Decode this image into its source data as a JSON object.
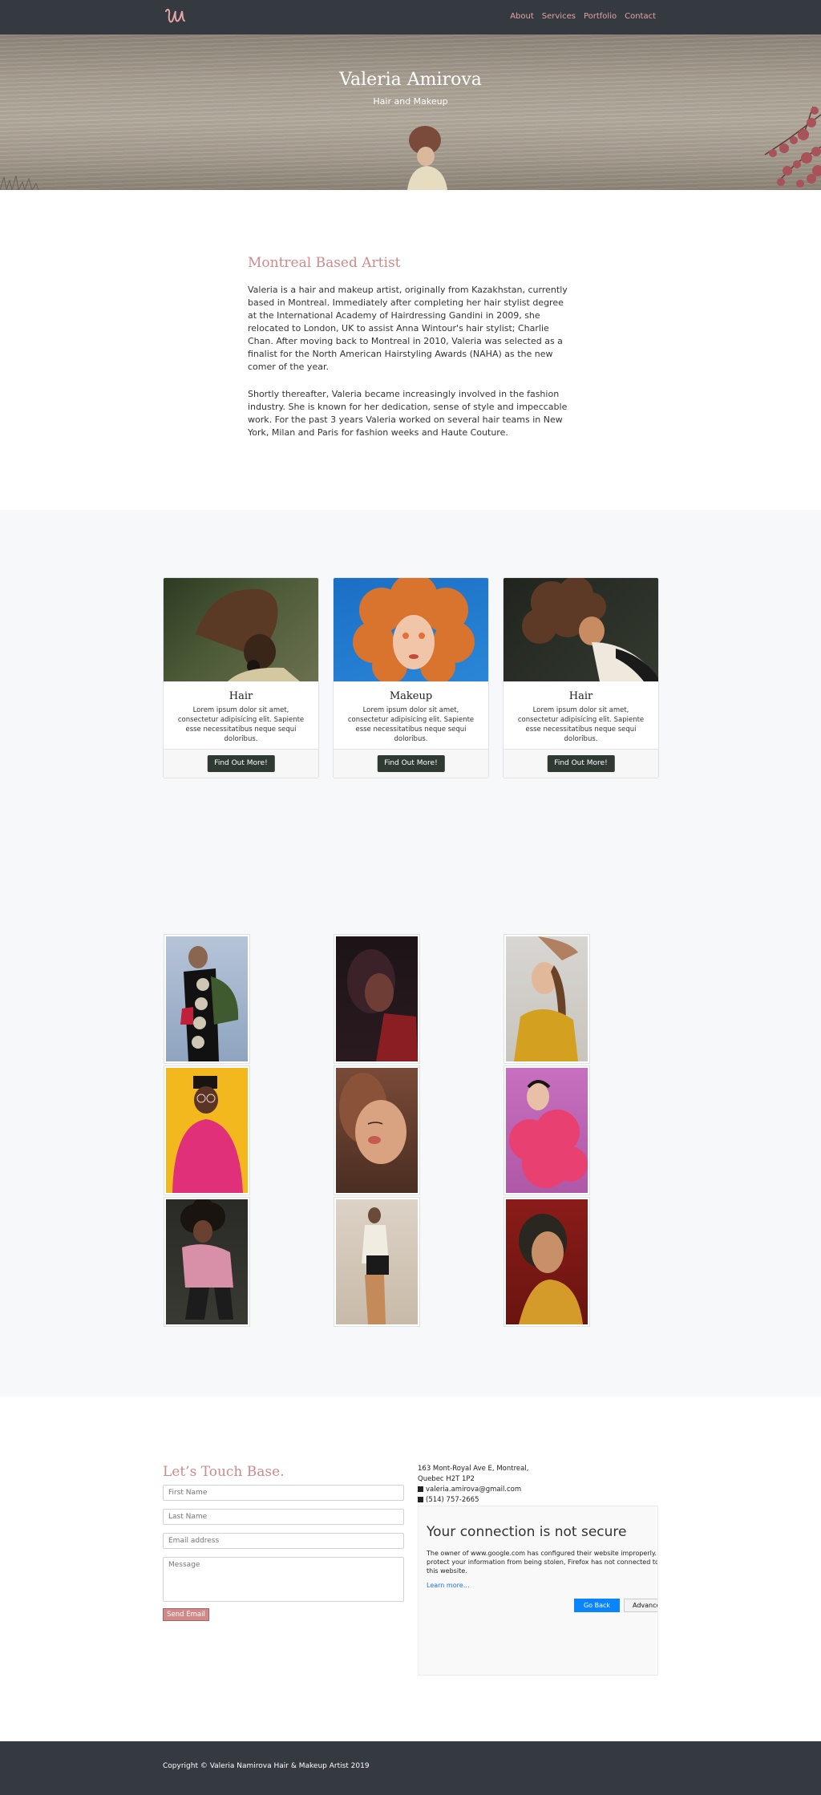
{
  "nav": {
    "logo": "Valeria Amirova logo",
    "links": [
      "About",
      "Services",
      "Portfolio",
      "Contact"
    ]
  },
  "hero": {
    "title": "Valeria Amirova",
    "subtitle": "Hair and Makeup"
  },
  "about": {
    "heading": "Montreal Based Artist",
    "paragraph1": "Valeria is a hair and makeup artist, originally from Kazakhstan, currently based in Montreal. Immediately after completing her hair stylist degree at the International Academy of Hairdressing Gandini in 2009, she relocated to London, UK to assist Anna Wintour's hair stylist; Charlie Chan. After moving back to Montreal in 2010, Valeria was selected as a finalist for the North American Hairstyling Awards (NAHA) as the new comer of the year.",
    "paragraph2": "Shortly thereafter, Valeria became increasingly involved in the fashion industry. She is known for her dedication, sense of style and impeccable work. For the past 3 years Valeria worked on several hair teams in New York, Milan and Paris for fashion weeks and Haute Couture."
  },
  "services": [
    {
      "title": "Hair",
      "text": "Lorem ipsum dolor sit amet, consectetur adipisicing elit. Sapiente esse necessitatibus neque sequi doloribus.",
      "button": "Find Out More!"
    },
    {
      "title": "Makeup",
      "text": "Lorem ipsum dolor sit amet, consectetur adipisicing elit. Sapiente esse necessitatibus neque sequi doloribus.",
      "button": "Find Out More!"
    },
    {
      "title": "Hair",
      "text": "Lorem ipsum dolor sit amet, consectetur adipisicing elit. Sapiente esse necessitatibus neque sequi doloribus.",
      "button": "Find Out More!"
    }
  ],
  "contact": {
    "heading": "Let’s Touch Base.",
    "first_name_placeholder": "First Name",
    "last_name_placeholder": "Last Name",
    "email_placeholder": "Email address",
    "message_placeholder": "Message",
    "send_label": "Send Email",
    "address_line1": "163 Mont-Royal Ave E, Montreal,",
    "address_line2": "Quebec H2T 1P2",
    "email": "valeria.amirova@gmail.com",
    "phone": "(514) 757-2665",
    "email_icon": "envelope-icon",
    "phone_icon": "phone-icon"
  },
  "map_error": {
    "title": "Your connection is not secure",
    "message": "The owner of www.google.com has configured their website improperly. To protect your information from being stolen, Firefox has not connected to this website.",
    "learn_more": "Learn more…",
    "go_back": "Go Back",
    "advanced": "Advanced"
  },
  "footer": {
    "copyright": "Copyright © Valeria Namirova Hair & Makeup Artist 2019"
  },
  "colors": {
    "nav_bg": "#343a40",
    "accent_pink": "#d08a8a",
    "button_dark": "#2f3a33",
    "section_gray": "#f7f8fa",
    "link_blue": "#0a84ff"
  }
}
